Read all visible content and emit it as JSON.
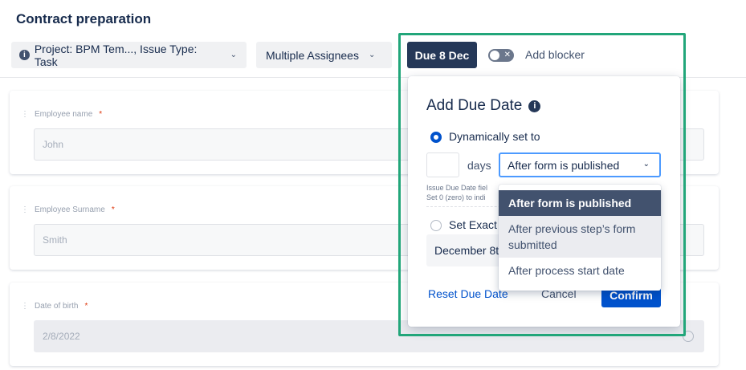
{
  "page": {
    "title": "Contract preparation"
  },
  "filters": {
    "project_label": "Project: BPM Tem..., Issue Type: Task",
    "assignees_label": "Multiple Assignees"
  },
  "form": {
    "fields": [
      {
        "label": "Employee name",
        "value": "John"
      },
      {
        "label": "Employee Surname",
        "value": "Smith"
      },
      {
        "label": "Date of birth",
        "value": "2/8/2022"
      }
    ]
  },
  "toolbar": {
    "due_badge": "Due 8 Dec",
    "add_blocker": "Add blocker"
  },
  "due_popup": {
    "title": "Add Due Date",
    "dynamic_label": "Dynamically set to",
    "days_unit": "days",
    "selected_option": "After form is published",
    "helper_text_1": "Issue Due Date fiel",
    "helper_text_2": "Set 0 (zero) to indi",
    "exact_label": "Set Exact",
    "exact_date": "December 8t",
    "reset_label": "Reset Due Date",
    "cancel_label": "Cancel",
    "confirm_label": "Confirm",
    "options": [
      "After form is published",
      "After previous step’s form submitted",
      "After process start date"
    ]
  },
  "colors": {
    "accent": "#0052cc",
    "badge": "#253858",
    "highlight": "#22a67a"
  }
}
